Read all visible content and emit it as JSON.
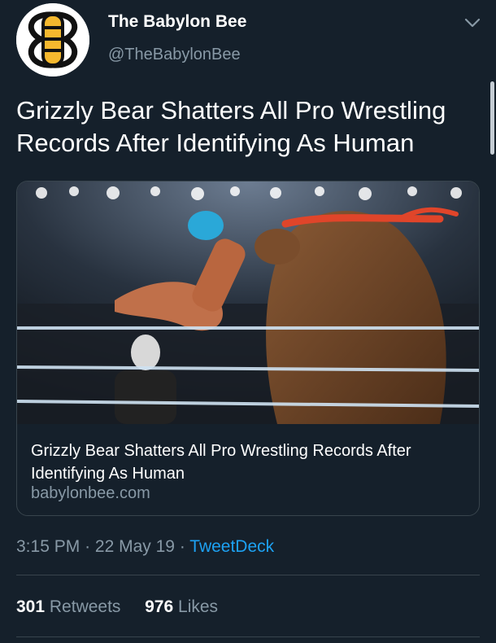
{
  "author": {
    "display_name": "The Babylon Bee",
    "handle": "@TheBabylonBee",
    "avatar_icon": "babylon-bee-logo-icon"
  },
  "menu_icon": "chevron-down-icon",
  "tweet": {
    "text": "Grizzly Bear Shatters All Pro Wrestling Records After Identifying As Human"
  },
  "card": {
    "image_icon": "bear-wrestling-photo",
    "title": "Grizzly Bear Shatters All Pro Wrestling Records After Identifying As Human",
    "domain": "babylonbee.com"
  },
  "meta": {
    "time": "3:15 PM",
    "separator": "·",
    "date": "22 May 19",
    "source": "TweetDeck"
  },
  "stats": {
    "retweets_count": "301",
    "retweets_label": "Retweets",
    "likes_count": "976",
    "likes_label": "Likes"
  },
  "colors": {
    "background": "#15202b",
    "secondary_text": "#8899a6",
    "link": "#1da1f2",
    "border": "#38444d",
    "logo_yellow": "#f5b82e"
  }
}
